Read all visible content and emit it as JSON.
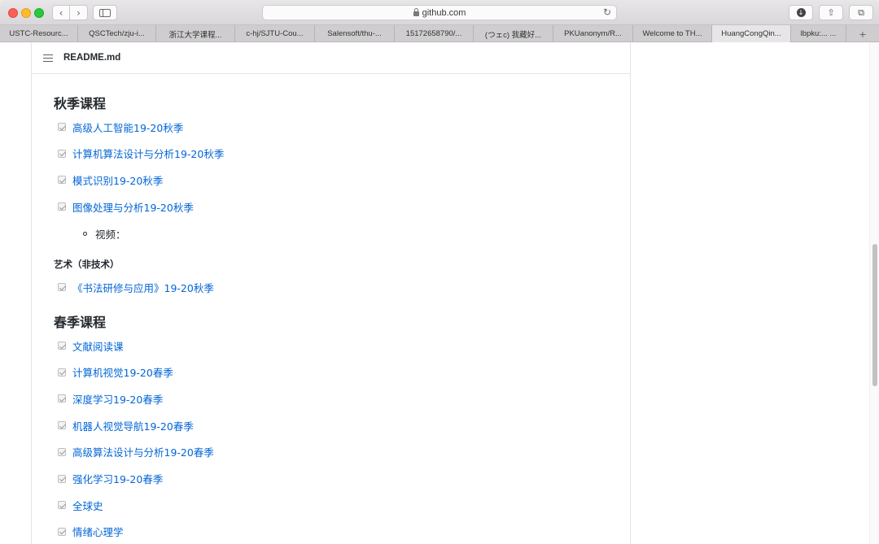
{
  "browser": {
    "url": "github.com",
    "tabs": [
      "USTC-Resourc...",
      "QSCTech/zju-i...",
      "浙江大学课程...",
      "c-hj/SJTU-Cou...",
      "Salensoft/thu-...",
      "15172658790/...",
      "(つェc) 我藏好...",
      "PKUanonym/R...",
      "Welcome to TH...",
      "HuangCongQin...",
      "lbpku:... ...",
      "+"
    ],
    "active_tab_index": 9
  },
  "readme": {
    "title": "README.md",
    "autumn_heading": "秋季课程",
    "autumn_items": [
      "高级人工智能19-20秋季",
      "计算机算法设计与分析19-20秋季",
      "模式识别19-20秋季",
      "图像处理与分析19-20秋季"
    ],
    "sub_item": "视频：",
    "art_heading": "艺术（非技术）",
    "art_items": [
      "《书法研修与应用》19-20秋季"
    ],
    "spring_heading": "春季课程",
    "spring_items": [
      "文献阅读课",
      "计算机视觉19-20春季",
      "深度学习19-20春季",
      "机器人视觉导航19-20春季",
      "高级算法设计与分析19-20春季",
      "强化学习19-20春季",
      "全球史",
      "情绪心理学"
    ]
  }
}
